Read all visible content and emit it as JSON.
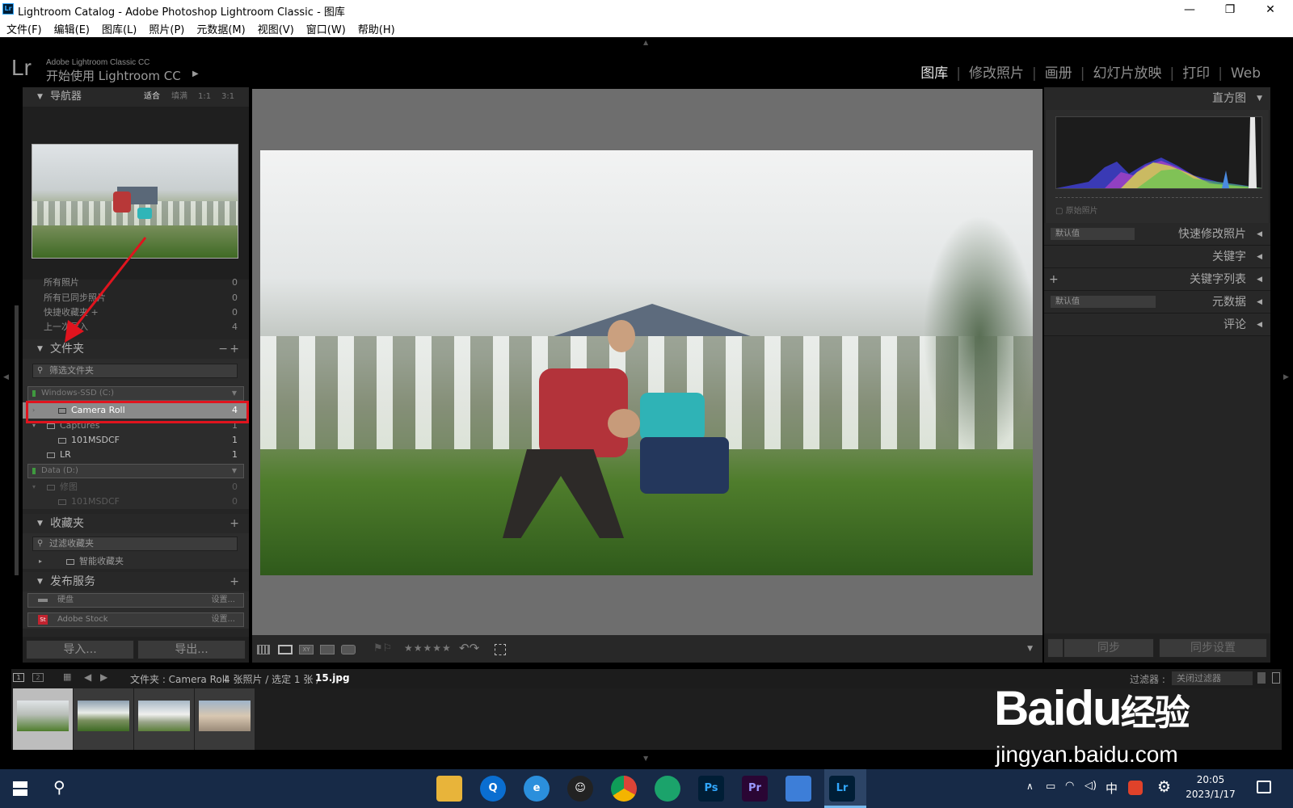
{
  "window": {
    "title": "Lightroom Catalog - Adobe Photoshop Lightroom Classic - 图库",
    "app_icon": "Lr",
    "minimize": "—",
    "restore": "❐",
    "close": "✕"
  },
  "menu": [
    "文件(F)",
    "编辑(E)",
    "图库(L)",
    "照片(P)",
    "元数据(M)",
    "视图(V)",
    "窗口(W)",
    "帮助(H)"
  ],
  "identity": {
    "logo": "Lr",
    "line1": "Adobe Lightroom Classic CC",
    "line2": "开始使用 Lightroom CC",
    "arrow": "▶"
  },
  "modules": [
    "图库",
    "修改照片",
    "画册",
    "幻灯片放映",
    "打印",
    "Web"
  ],
  "navigator": {
    "title": "导航器",
    "zoom_options": [
      "适合",
      "填满",
      "1:1",
      "3:1"
    ]
  },
  "catalog": {
    "rows": [
      {
        "label": "所有照片",
        "count": "0"
      },
      {
        "label": "所有已同步照片",
        "count": "0"
      },
      {
        "label": "快捷收藏夹 +",
        "count": "0"
      },
      {
        "label": "上一次导入",
        "count": "4"
      }
    ]
  },
  "folders": {
    "title": "文件夹",
    "minus": "−",
    "plus": "+",
    "filter_placeholder": "筛选文件夹",
    "volume_c": "Windows-SSD (C:)",
    "volume_d": "Data (D:)",
    "items": [
      {
        "label": "Camera Roll",
        "count": "4"
      },
      {
        "label": "Captures",
        "count": "1"
      },
      {
        "label": "101MSDCF",
        "count": "1"
      },
      {
        "label": "LR",
        "count": "1"
      },
      {
        "label": "修图",
        "count": "0"
      },
      {
        "label": "101MSDCF",
        "count": "0"
      }
    ]
  },
  "collections": {
    "title": "收藏夹",
    "plus": "+",
    "filter_placeholder": "过滤收藏夹",
    "smart": "智能收藏夹"
  },
  "publish": {
    "title": "发布服务",
    "plus": "+",
    "items": [
      {
        "label": "硬盘",
        "action": "设置..."
      },
      {
        "label": "Adobe Stock",
        "action": "设置..."
      }
    ]
  },
  "left_buttons": {
    "import": "导入...",
    "export": "导出..."
  },
  "right": {
    "histogram": "直方图",
    "original_photo": "原始照片",
    "quick_develop": "快速修改照片",
    "preset_default": "默认值",
    "keywords": "关键字",
    "keyword_list": "关键字列表",
    "keyword_plus": "+",
    "metadata": "元数据",
    "metadata_default": "默认值",
    "comments": "评论",
    "sync": "同步",
    "sync_settings": "同步设置",
    "collapse_arrow": "◀"
  },
  "toolbar": {
    "stars": "★★★★★"
  },
  "filmstrip_bar": {
    "page1": "1",
    "page2": "2",
    "source": "文件夹 : Camera Roll",
    "info": "4 张照片 / 选定 1 张 /",
    "filename": "15.jpg",
    "filter_label": "过滤器 :",
    "filter_value": "关闭过滤器"
  },
  "taskbar": {
    "time": "20:05",
    "date": "2023/1/17",
    "ime": "中",
    "apps": [
      "Ps",
      "Pr",
      "Lr"
    ]
  },
  "watermark": {
    "brand": "Bai",
    "brand2": "du",
    "brand3": "经验",
    "url": "jingyan.baidu.com"
  },
  "colors": {
    "accent_red": "#e0141e",
    "ps_blue": "#31a8ff",
    "pr_purple": "#9999ff",
    "lr_blue": "#31a8ff"
  }
}
